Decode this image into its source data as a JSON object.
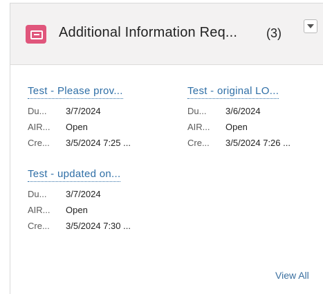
{
  "card": {
    "title": "Additional Information Req...",
    "count": "(3)",
    "icon": "record-icon",
    "accent_color": "#e0567c",
    "menu_icon": "chevron-down-icon",
    "view_all_label": "View All",
    "records": [
      {
        "title": "Test - Please prov...",
        "fields": [
          {
            "label": "Du...",
            "value": "3/7/2024"
          },
          {
            "label": "AIR...",
            "value": "Open"
          },
          {
            "label": "Cre...",
            "value": "3/5/2024 7:25 ..."
          }
        ]
      },
      {
        "title": "Test - original LO...",
        "fields": [
          {
            "label": "Du...",
            "value": "3/6/2024"
          },
          {
            "label": "AIR...",
            "value": "Open"
          },
          {
            "label": "Cre...",
            "value": "3/5/2024 7:26 ..."
          }
        ]
      },
      {
        "title": "Test - updated on...",
        "fields": [
          {
            "label": "Du...",
            "value": "3/7/2024"
          },
          {
            "label": "AIR...",
            "value": "Open"
          },
          {
            "label": "Cre...",
            "value": "3/5/2024 7:30 ..."
          }
        ]
      }
    ]
  }
}
